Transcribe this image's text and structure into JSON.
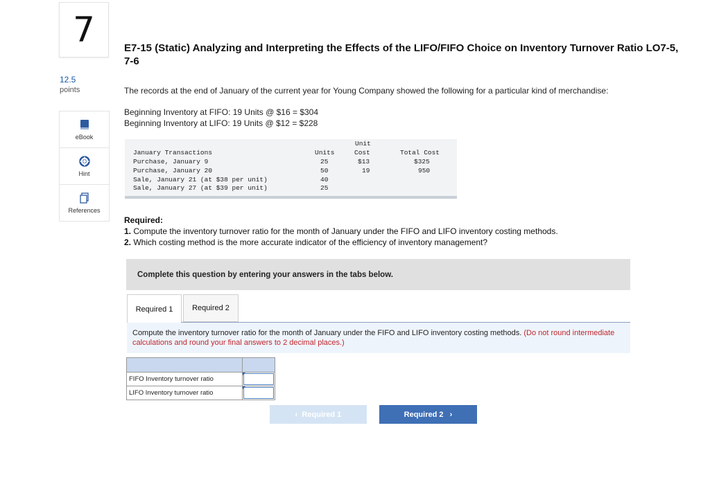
{
  "question": {
    "number": "7",
    "points_value": "12.5",
    "points_label": "points",
    "title": "E7-15 (Static) Analyzing and Interpreting the Effects of the LIFO/FIFO Choice on Inventory Turnover Ratio LO7-5, 7-6",
    "intro": "The records at the end of January of the current year for Young Company showed the following for a particular kind of merchandise:",
    "begin_fifo": "Beginning Inventory at FIFO: 19 Units @ $16 = $304",
    "begin_lifo": "Beginning Inventory at LIFO: 19 Units @ $12 = $228"
  },
  "tools": [
    {
      "label": "eBook",
      "icon": "book-icon"
    },
    {
      "label": "Hint",
      "icon": "lifebuoy-icon"
    },
    {
      "label": "References",
      "icon": "pages-icon"
    }
  ],
  "transactions": {
    "headers": {
      "col1": "January Transactions",
      "units": "Units",
      "unit_cost_line1": "Unit",
      "unit_cost_line2": "Cost",
      "total": "Total Cost"
    },
    "rows": [
      {
        "desc": "Purchase, January 9",
        "units": "25",
        "cost": "$13",
        "total": "$325"
      },
      {
        "desc": "Purchase, January 20",
        "units": "50",
        "cost": "19",
        "total": "950"
      },
      {
        "desc": "Sale, January 21 (at $38 per unit)",
        "units": "40",
        "cost": "",
        "total": ""
      },
      {
        "desc": "Sale, January 27 (at $39 per unit)",
        "units": "25",
        "cost": "",
        "total": ""
      }
    ]
  },
  "required": {
    "heading": "Required:",
    "item1_num": "1.",
    "item1": "Compute the inventory turnover ratio for the month of January under the FIFO and LIFO inventory costing methods.",
    "item2_num": "2.",
    "item2": "Which costing method is the more accurate indicator of the efficiency of inventory management?"
  },
  "complete_banner": "Complete this question by entering your answers in the tabs below.",
  "tabs": [
    "Required 1",
    "Required 2"
  ],
  "instruction": {
    "main": "Compute the inventory turnover ratio for the month of January under the FIFO and LIFO inventory costing methods.",
    "note": "(Do not round intermediate calculations and round your final answers to 2 decimal places.)"
  },
  "answer_rows": [
    {
      "label": "FIFO Inventory turnover ratio",
      "value": ""
    },
    {
      "label": "LIFO Inventory turnover ratio",
      "value": ""
    }
  ],
  "nav": {
    "prev": "Required 1",
    "next": "Required 2"
  }
}
